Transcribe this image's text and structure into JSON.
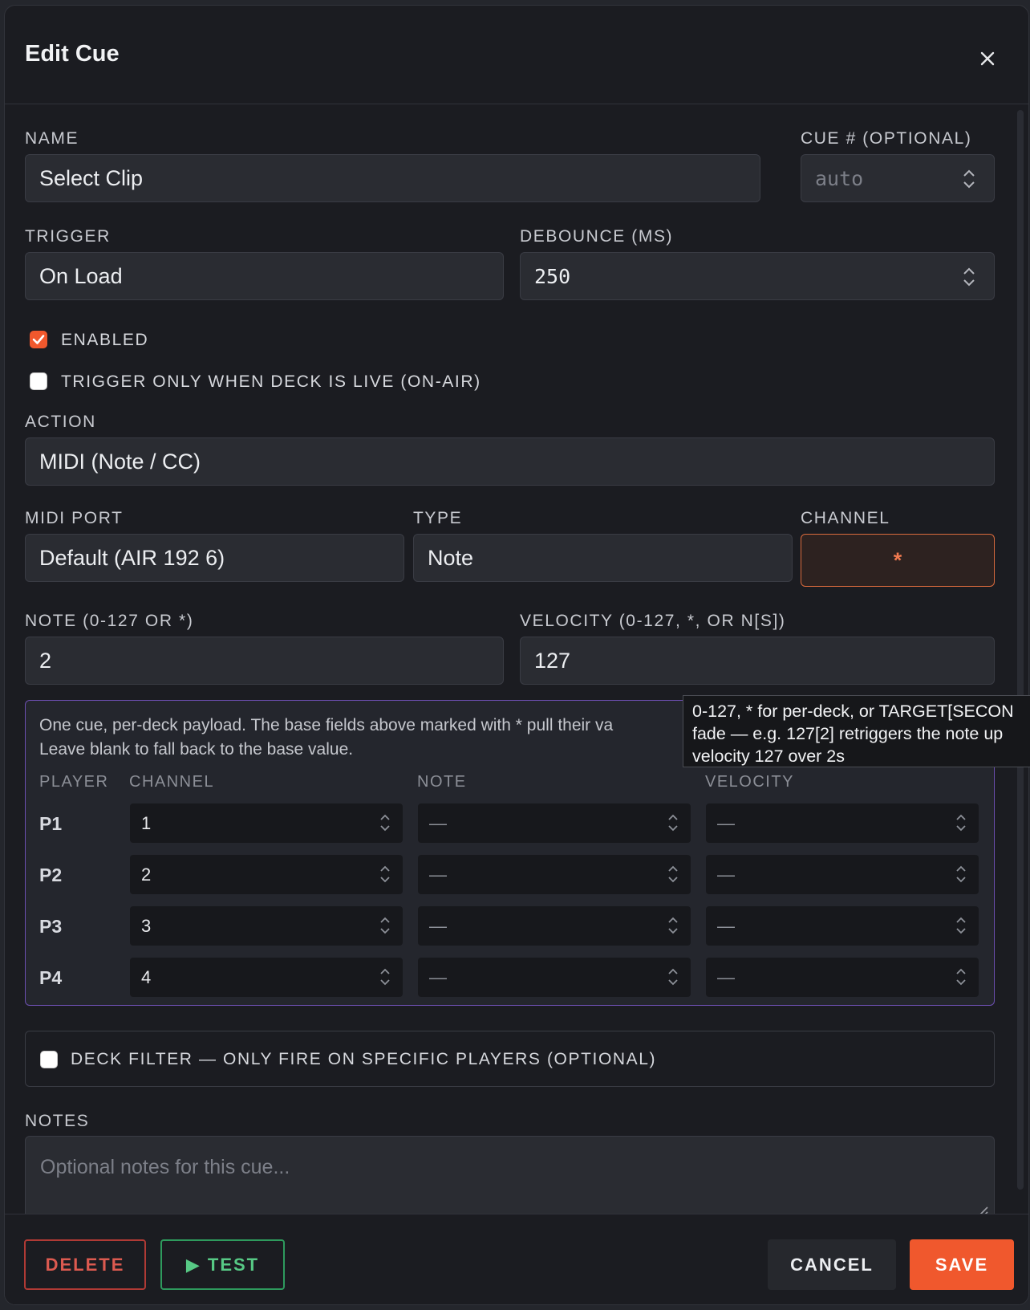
{
  "dialog": {
    "title": "Edit Cue"
  },
  "form": {
    "name": {
      "label": "NAME",
      "value": "Select Clip"
    },
    "cue_number": {
      "label": "CUE # (OPTIONAL)",
      "placeholder": "auto"
    },
    "trigger": {
      "label": "TRIGGER",
      "value": "On Load"
    },
    "debounce": {
      "label": "DEBOUNCE (MS)",
      "value": "250"
    },
    "enabled": {
      "label": "ENABLED",
      "checked": true
    },
    "live_only": {
      "label": "TRIGGER ONLY WHEN DECK IS LIVE (ON-AIR)",
      "checked": false
    },
    "action": {
      "label": "ACTION",
      "value": "MIDI (Note / CC)"
    },
    "midi_port": {
      "label": "MIDI PORT",
      "value": "Default (AIR 192 6)"
    },
    "type": {
      "label": "TYPE",
      "value": "Note"
    },
    "channel": {
      "label": "CHANNEL",
      "value": "*"
    },
    "note": {
      "label": "NOTE (0-127 OR *)",
      "value": "2"
    },
    "velocity": {
      "label": "VELOCITY (0-127, *, OR N[S])",
      "value": "127"
    }
  },
  "per_deck": {
    "info_line1": "One cue, per-deck payload. The base fields above marked with * pull their va",
    "info_line2": "Leave blank to fall back to the base value.",
    "headers": {
      "player": "PLAYER",
      "channel": "CHANNEL",
      "note": "NOTE",
      "velocity": "VELOCITY"
    },
    "rows": [
      {
        "player": "P1",
        "channel": "1",
        "note": "—",
        "velocity": "—"
      },
      {
        "player": "P2",
        "channel": "2",
        "note": "—",
        "velocity": "—"
      },
      {
        "player": "P3",
        "channel": "3",
        "note": "—",
        "velocity": "—"
      },
      {
        "player": "P4",
        "channel": "4",
        "note": "—",
        "velocity": "—"
      }
    ]
  },
  "tooltip": {
    "line1": "0-127, * for per-deck, or TARGET[SECON",
    "line2": "fade — e.g. 127[2] retriggers the note up",
    "line3": "velocity 127 over 2s"
  },
  "deck_filter": {
    "label": "DECK FILTER — ONLY FIRE ON SPECIFIC PLAYERS (OPTIONAL)",
    "checked": false
  },
  "notes": {
    "label": "NOTES",
    "placeholder": "Optional notes for this cue..."
  },
  "footer": {
    "delete_label": "DELETE",
    "test_label": "▶ TEST",
    "cancel_label": "CANCEL",
    "save_label": "SAVE"
  },
  "colors": {
    "accent": "#f0582d",
    "danger": "#dc5a50",
    "success": "#57c985",
    "panel_border": "#6c4fb0"
  },
  "icons": {
    "close": "close-icon",
    "spin": "chevron-updown-icon",
    "check": "check-icon",
    "resize": "resize-handle-icon"
  }
}
